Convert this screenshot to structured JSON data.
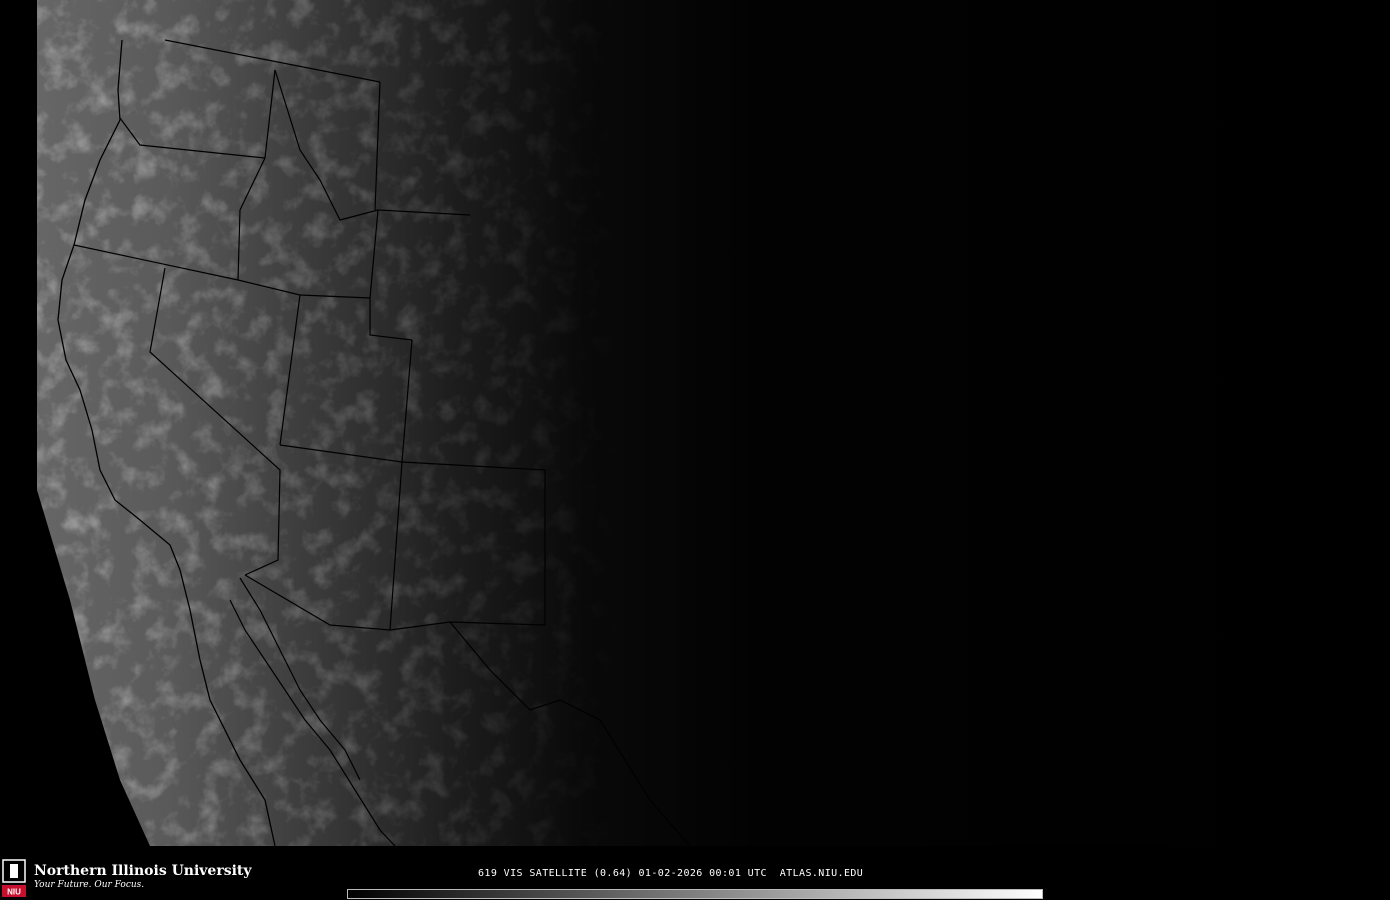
{
  "footer": {
    "university_name": "Northern Illinois University",
    "tagline": "Your Future. Our Focus.",
    "logo_text": "NIU",
    "caption": "619 VIS SATELLITE (0.64) 01-02-2026 00:01 UTC  ATLAS.NIU.EDU"
  },
  "colors": {
    "background": "#000000",
    "state_borders": "#000000",
    "brand_red": "#c8102e"
  },
  "colorbar": {
    "from": "#000000",
    "to": "#ffffff"
  }
}
